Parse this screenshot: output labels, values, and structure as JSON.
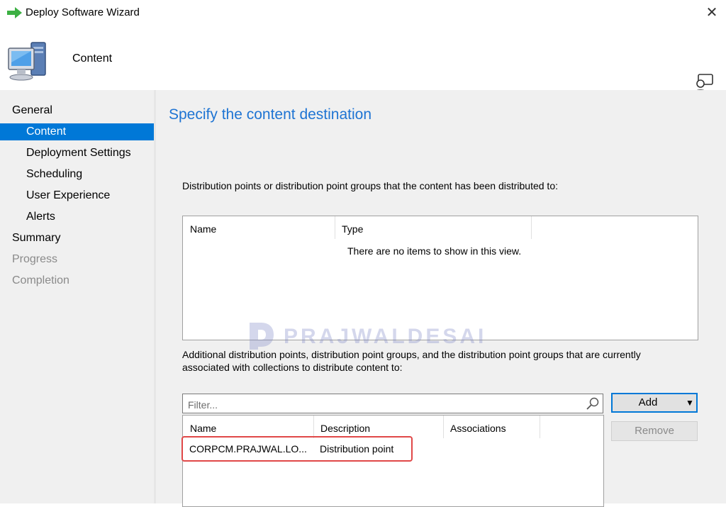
{
  "window": {
    "title": "Deploy Software Wizard",
    "close_glyph": "✕"
  },
  "header": {
    "title": "Content",
    "icon": "computer-icon"
  },
  "nav": {
    "items": [
      {
        "label": "General",
        "state": "normal"
      },
      {
        "label": "Content",
        "state": "active"
      },
      {
        "label": "Deployment Settings",
        "state": "normal"
      },
      {
        "label": "Scheduling",
        "state": "normal"
      },
      {
        "label": "User Experience",
        "state": "normal"
      },
      {
        "label": "Alerts",
        "state": "normal"
      },
      {
        "label": "Summary",
        "state": "normal"
      },
      {
        "label": "Progress",
        "state": "disabled"
      },
      {
        "label": "Completion",
        "state": "disabled"
      }
    ]
  },
  "main": {
    "heading": "Specify the content destination",
    "distributed_label": "Distribution points or distribution point groups that the content has been distributed to:",
    "distributed_list": {
      "columns": [
        "Name",
        "Type"
      ],
      "empty_message": "There are no items to show in this view."
    },
    "additional_label_line1": "Additional distribution points, distribution point groups, and the distribution point groups that are currently",
    "additional_label_line2": "associated with collections to distribute content to:",
    "filter": {
      "placeholder": "Filter...",
      "value": ""
    },
    "additional_list": {
      "columns": [
        "Name",
        "Description",
        "Associations"
      ],
      "rows": [
        {
          "name": "CORPCM.PRAJWAL.LO...",
          "description": "Distribution point",
          "associations": ""
        }
      ]
    },
    "buttons": {
      "add": "Add",
      "add_arrow": "▼",
      "remove": "Remove"
    }
  },
  "watermark": {
    "text": "PRAJWALDESAI"
  },
  "colors": {
    "accent": "#0078d7",
    "heading": "#1e74d3",
    "highlight": "#e04848"
  }
}
